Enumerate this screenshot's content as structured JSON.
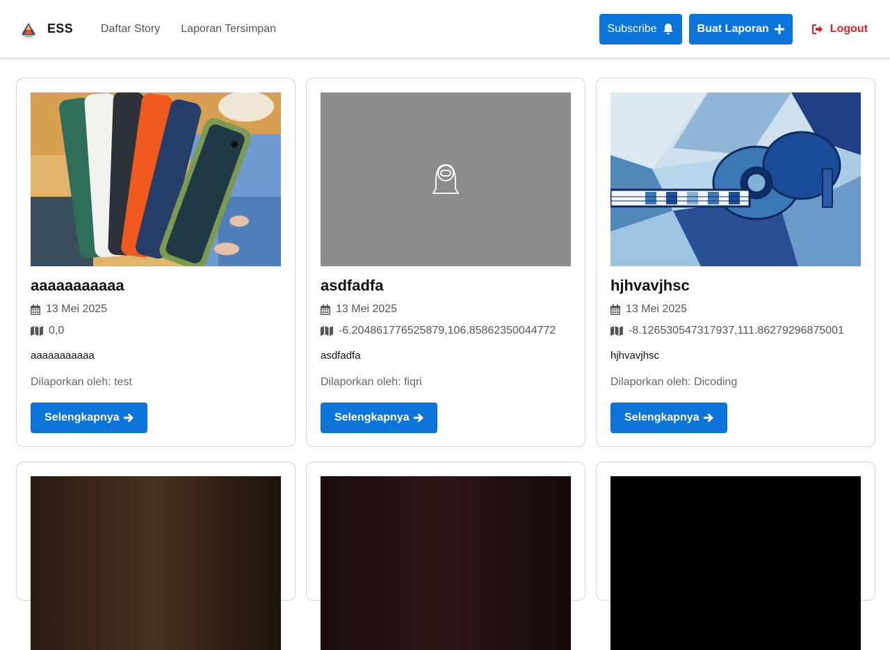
{
  "navbar": {
    "brand": "ESS",
    "links": [
      "Daftar Story",
      "Laporan Tersimpan"
    ],
    "subscribe_label": "Subscribe",
    "create_label": "Buat Laporan",
    "logout_label": "Logout"
  },
  "colors": {
    "primary": "#0a74da",
    "danger": "#e0211f",
    "placeholder": "#8c8c8c"
  },
  "reporter_prefix": "Dilaporkan oleh: ",
  "more_label": "Selengkapnya",
  "stories": [
    {
      "title": "aaaaaaaaaaa",
      "date": "13 Mei 2025",
      "location": "0,0",
      "description": "aaaaaaaaaaa",
      "reporter": "Dilaporkan oleh: test",
      "image": "phone-cases-photo"
    },
    {
      "title": "asdfadfa",
      "date": "13 Mei 2025",
      "location": "-6.204861776525879,106.85862350044772",
      "description": "asdfadfa",
      "reporter": "Dilaporkan oleh: fiqri",
      "image": "placeholder-camera-icon"
    },
    {
      "title": "hjhvavjhsc",
      "date": "13 Mei 2025",
      "location": "-8.126530547317937,111.86279296875001",
      "description": "hjhvavjhsc",
      "reporter": "Dilaporkan oleh: Dicoding",
      "image": "guitar-painting"
    }
  ]
}
